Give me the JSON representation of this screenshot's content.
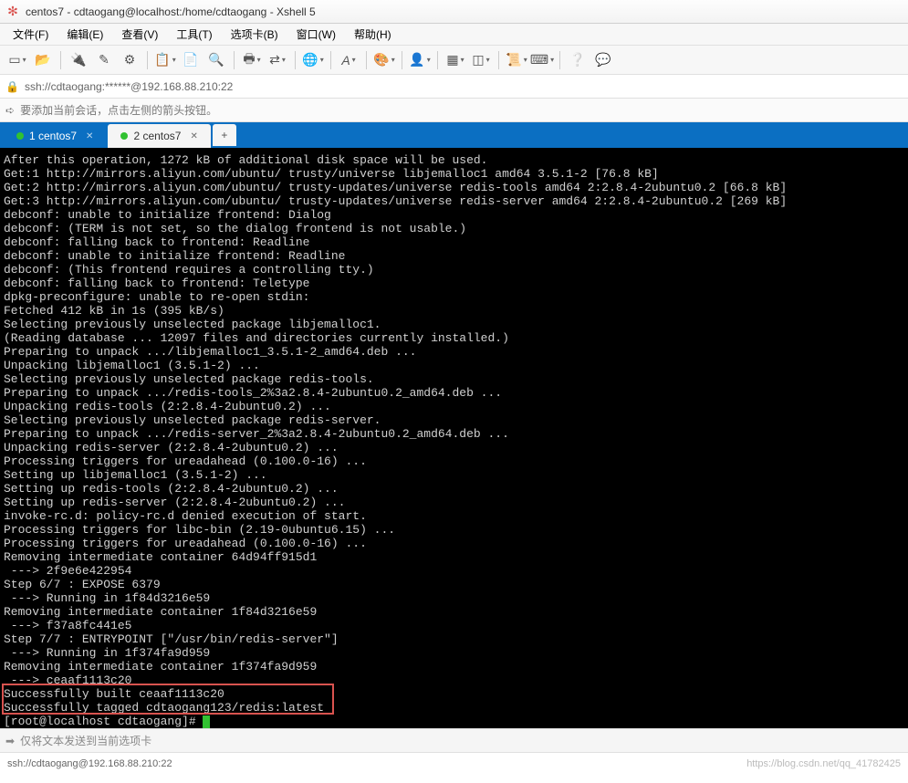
{
  "window": {
    "title": "centos7 - cdtaogang@localhost:/home/cdtaogang - Xshell 5"
  },
  "menu": {
    "file": "文件(F)",
    "edit": "编辑(E)",
    "view": "查看(V)",
    "tools": "工具(T)",
    "tabs": "选项卡(B)",
    "window": "窗口(W)",
    "help": "帮助(H)"
  },
  "address": {
    "text": "ssh://cdtaogang:******@192.168.88.210:22"
  },
  "hint": {
    "text": "要添加当前会话，点击左侧的箭头按钮。"
  },
  "tabs": {
    "t1": "1 centos7",
    "t2": "2 centos7",
    "add": "+"
  },
  "terminal": {
    "lines": [
      "After this operation, 1272 kB of additional disk space will be used.",
      "Get:1 http://mirrors.aliyun.com/ubuntu/ trusty/universe libjemalloc1 amd64 3.5.1-2 [76.8 kB]",
      "Get:2 http://mirrors.aliyun.com/ubuntu/ trusty-updates/universe redis-tools amd64 2:2.8.4-2ubuntu0.2 [66.8 kB]",
      "Get:3 http://mirrors.aliyun.com/ubuntu/ trusty-updates/universe redis-server amd64 2:2.8.4-2ubuntu0.2 [269 kB]",
      "debconf: unable to initialize frontend: Dialog",
      "debconf: (TERM is not set, so the dialog frontend is not usable.)",
      "debconf: falling back to frontend: Readline",
      "debconf: unable to initialize frontend: Readline",
      "debconf: (This frontend requires a controlling tty.)",
      "debconf: falling back to frontend: Teletype",
      "dpkg-preconfigure: unable to re-open stdin:",
      "Fetched 412 kB in 1s (395 kB/s)",
      "Selecting previously unselected package libjemalloc1.",
      "(Reading database ... 12097 files and directories currently installed.)",
      "Preparing to unpack .../libjemalloc1_3.5.1-2_amd64.deb ...",
      "Unpacking libjemalloc1 (3.5.1-2) ...",
      "Selecting previously unselected package redis-tools.",
      "Preparing to unpack .../redis-tools_2%3a2.8.4-2ubuntu0.2_amd64.deb ...",
      "Unpacking redis-tools (2:2.8.4-2ubuntu0.2) ...",
      "Selecting previously unselected package redis-server.",
      "Preparing to unpack .../redis-server_2%3a2.8.4-2ubuntu0.2_amd64.deb ...",
      "Unpacking redis-server (2:2.8.4-2ubuntu0.2) ...",
      "Processing triggers for ureadahead (0.100.0-16) ...",
      "Setting up libjemalloc1 (3.5.1-2) ...",
      "Setting up redis-tools (2:2.8.4-2ubuntu0.2) ...",
      "Setting up redis-server (2:2.8.4-2ubuntu0.2) ...",
      "invoke-rc.d: policy-rc.d denied execution of start.",
      "Processing triggers for libc-bin (2.19-0ubuntu6.15) ...",
      "Processing triggers for ureadahead (0.100.0-16) ...",
      "Removing intermediate container 64d94ff915d1",
      " ---> 2f9e6e422954",
      "Step 6/7 : EXPOSE 6379",
      " ---> Running in 1f84d3216e59",
      "Removing intermediate container 1f84d3216e59",
      " ---> f37a8fc441e5",
      "Step 7/7 : ENTRYPOINT [\"/usr/bin/redis-server\"]",
      " ---> Running in 1f374fa9d959",
      "Removing intermediate container 1f374fa9d959",
      " ---> ceaaf1113c20",
      "Successfully built ceaaf1113c20",
      "Successfully tagged cdtaogang123/redis:latest"
    ],
    "prompt": "[root@localhost cdtaogang]# "
  },
  "sendbar": {
    "placeholder": "仅将文本发送到当前选项卡"
  },
  "status": {
    "left": "ssh://cdtaogang@192.168.88.210:22",
    "watermark": "https://blog.csdn.net/qq_41782425"
  }
}
